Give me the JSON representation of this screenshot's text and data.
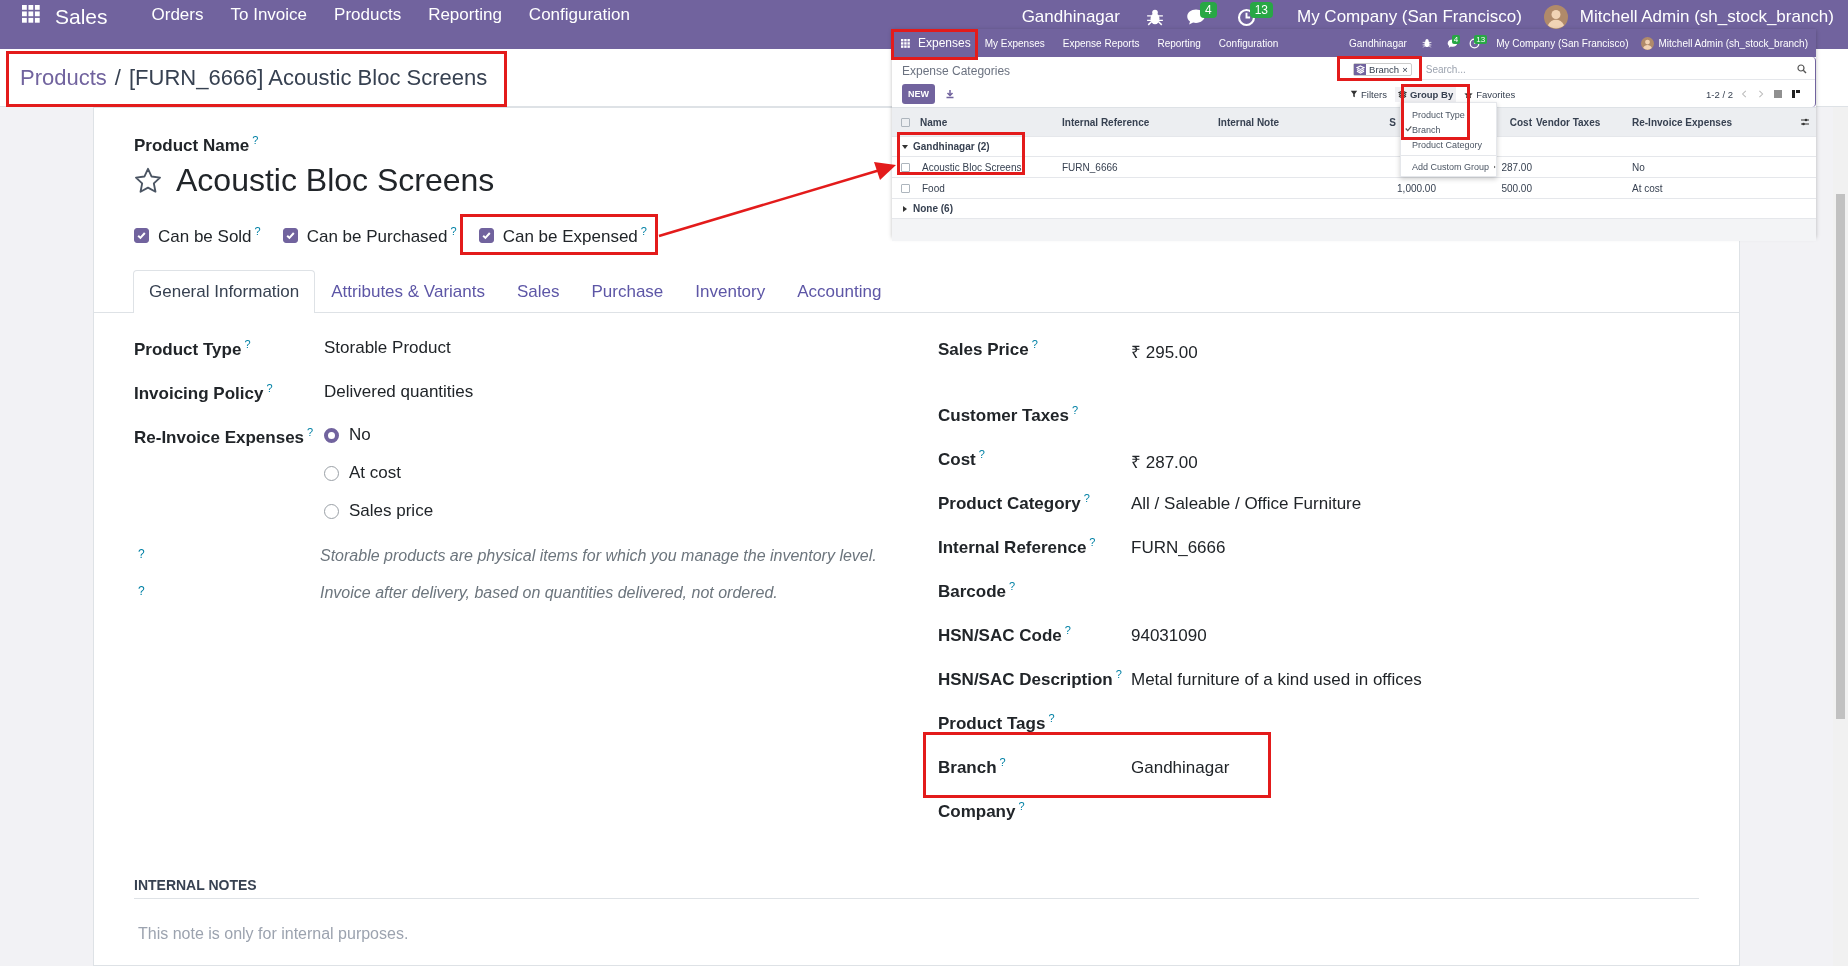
{
  "topbar": {
    "app": "Sales",
    "menu": [
      "Orders",
      "To Invoice",
      "Products",
      "Reporting",
      "Configuration"
    ],
    "branch": "Gandhinagar",
    "messages_count": "4",
    "activities_count": "13",
    "company": "My Company (San Francisco)",
    "user": "Mitchell Admin (sh_stock_branch)"
  },
  "breadcrumb": {
    "parent": "Products",
    "separator": "/",
    "current": "[FURN_6666] Acoustic Bloc Screens"
  },
  "form": {
    "name_label": "Product Name$^{?}$",
    "name": "Acoustic Bloc Screens",
    "options": [
      {
        "label": "Can be Sold$^{?}$",
        "checked": true
      },
      {
        "label": "Can be Purchased$^{?}$",
        "checked": true
      },
      {
        "label": "Can be Expensed$^{?}$",
        "checked": true
      }
    ],
    "tabs": [
      {
        "label": "General Information",
        "selected": true
      },
      {
        "label": "Attributes & Variants",
        "selected": false
      },
      {
        "label": "Sales",
        "selected": false
      },
      {
        "label": "Purchase",
        "selected": false
      },
      {
        "label": "Inventory",
        "selected": false
      },
      {
        "label": "Accounting",
        "selected": false
      }
    ],
    "left_fields": [
      {
        "kind": "text",
        "label": "Product Type$^{?}$",
        "value": "Storable Product"
      },
      {
        "kind": "text",
        "label": "Invoicing Policy$^{?}$",
        "value": "Delivered quantities"
      },
      {
        "kind": "radio",
        "label": "Re-Invoice Expenses$^{?}$",
        "options": [
          {
            "label": "No",
            "selected": true
          },
          {
            "label": "At cost",
            "selected": false
          },
          {
            "label": "Sales price",
            "selected": false
          }
        ]
      }
    ],
    "help_notes": [
      {
        "mark": "?",
        "text": "Storable products are physical items for which you manage the inventory level."
      },
      {
        "mark": "?",
        "text": "Invoice after delivery, based on quantities delivered, not ordered."
      }
    ],
    "right_fields": [
      {
        "label": "Sales Price$^{?}$",
        "value": "₹ 295.00"
      },
      {
        "label": "Customer Taxes$^{?}$"
      },
      {
        "label": "Cost$^{?}$",
        "value": "₹ 287.00"
      },
      {
        "label": "Product Category$^{?}$",
        "value": "All / Saleable / Office Furniture"
      },
      {
        "label": "Internal Reference$^{?}$",
        "value": "FURN_6666"
      },
      {
        "label": "Barcode$^{?}$"
      },
      {
        "label": "HSN/SAC Code$^{?}$",
        "value": "94031090"
      },
      {
        "label": "HSN/SAC Description$^{?}$",
        "value": "Metal furniture of a kind used in offices"
      },
      {
        "label": "Product Tags$^{?}$"
      },
      {
        "label": "Branch$^{?}$",
        "value": "Gandhinagar"
      },
      {
        "label": "Company$^{?}$"
      }
    ],
    "notes": {
      "title": "INTERNAL NOTES",
      "placeholder": "This note is only for internal purposes."
    }
  },
  "inset": {
    "app": "Expenses",
    "menu": [
      "My Expenses",
      "Expense Reports",
      "Reporting",
      "Configuration"
    ],
    "branch": "Gandhinagar",
    "messages_count": "4",
    "activities_count": "13",
    "company": "My Company (San Francisco)",
    "user": "Mitchell Admin (sh_stock_branch)",
    "title": "Expense Categories",
    "new_button": "NEW",
    "facet": {
      "label": "Branch",
      "remove": "×"
    },
    "search_placeholder": "Search...",
    "filters": "Filters",
    "group_by": "Group By",
    "favorites": "Favorites",
    "pager": "1-2 / 2",
    "all_selected": false,
    "columns": [
      "Name",
      "Internal Reference",
      "Internal Note",
      "S",
      "Cost",
      "Vendor Taxes",
      "Re-Invoice Expenses"
    ],
    "groups": [
      {
        "label": "Gandhinagar (2)",
        "expanded": true,
        "rows": [
          {
            "selected": false,
            "name": "Acoustic Bloc Screens",
            "internal_reference": "FURN_6666",
            "cost": "287.00",
            "re_invoice_expenses": "No"
          },
          {
            "selected": false,
            "name": "Food",
            "sales_price": "1,000.00",
            "cost": "500.00",
            "re_invoice_expenses": "At cost"
          }
        ]
      },
      {
        "label": "None (6)",
        "expanded": false
      }
    ],
    "group_menu": [
      {
        "label": "Product Type",
        "checked": false
      },
      {
        "label": "Branch",
        "checked": true
      },
      {
        "label": "Product Category",
        "checked": false
      }
    ],
    "custom_group": "Add Custom Group"
  }
}
